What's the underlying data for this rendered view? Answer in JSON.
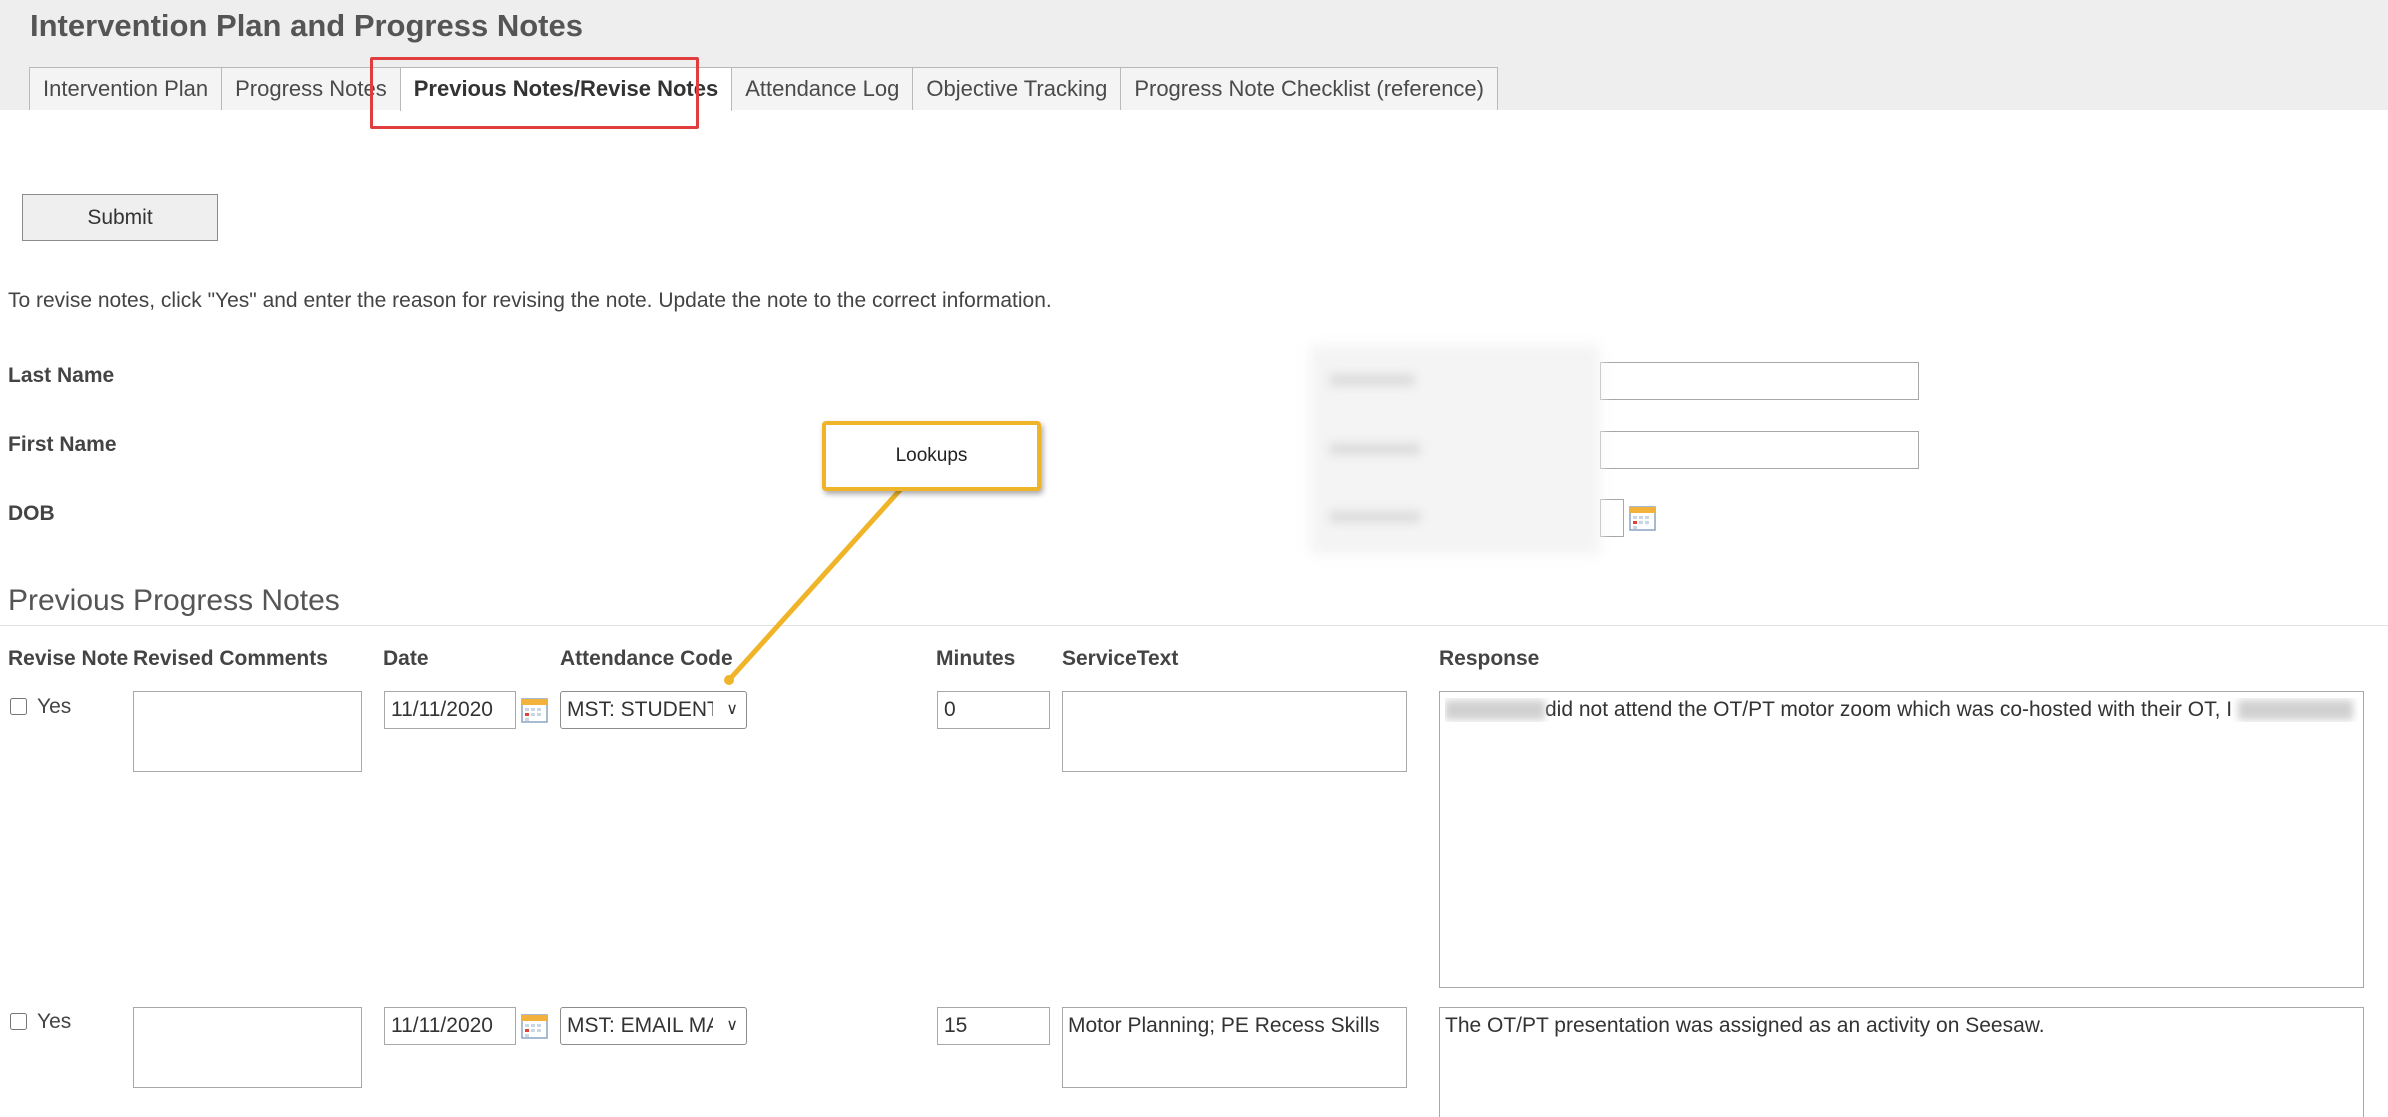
{
  "header": {
    "title": "Intervention Plan and Progress Notes",
    "tabs": [
      {
        "label": "Intervention Plan",
        "active": false
      },
      {
        "label": "Progress Notes",
        "active": false
      },
      {
        "label": "Previous Notes/Revise Notes",
        "active": true
      },
      {
        "label": "Attendance Log",
        "active": false
      },
      {
        "label": "Objective Tracking",
        "active": false
      },
      {
        "label": "Progress Note Checklist (reference)",
        "active": false
      }
    ],
    "highlight_color": "#e03e3e"
  },
  "form": {
    "submit_label": "Submit",
    "instructions": "To revise notes, click \"Yes\" and enter the reason for revising the note. Update the note to the correct information.",
    "last_name_label": "Last Name",
    "first_name_label": "First Name",
    "dob_label": "DOB"
  },
  "notes": {
    "section_title": "Previous Progress Notes",
    "columns": {
      "revise_note": "Revise Note",
      "revised_comments": "Revised Comments",
      "date": "Date",
      "attendance_code": "Attendance Code",
      "minutes": "Minutes",
      "service_text": "ServiceText",
      "response": "Response"
    },
    "rows": [
      {
        "yes_label": "Yes",
        "checked": false,
        "revised_comments": "",
        "date": "11/11/2020",
        "attendance_code": "MST: STUDENT",
        "minutes": "0",
        "service_text": "",
        "response": "did not attend the OT/PT motor zoom which was co-hosted with their OT, I"
      },
      {
        "yes_label": "Yes",
        "checked": false,
        "revised_comments": "",
        "date": "11/11/2020",
        "attendance_code": "MST: EMAIL MA",
        "minutes": "15",
        "service_text": "Motor Planning; PE Recess Skills",
        "response": "The OT/PT presentation was assigned as an activity on Seesaw."
      }
    ]
  },
  "callout": {
    "label": "Lookups",
    "color": "#f0b429"
  }
}
